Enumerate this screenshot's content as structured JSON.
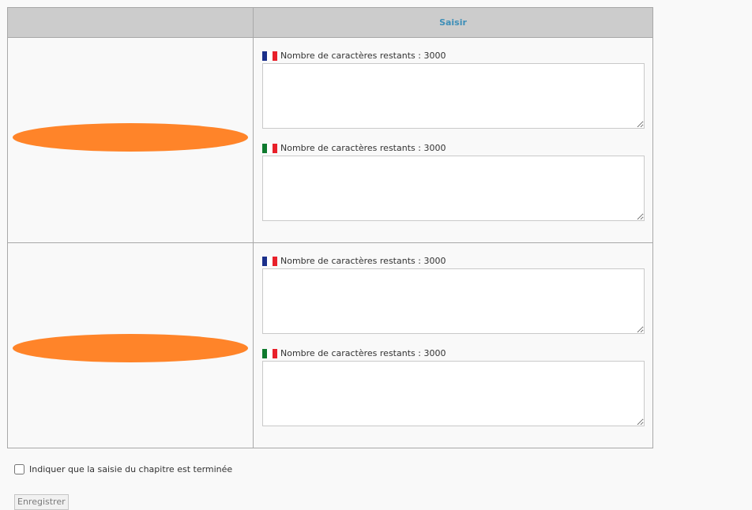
{
  "table": {
    "header_left": "",
    "header_right": "Saisir"
  },
  "flags": {
    "fr": {
      "left": "#1a2f8a",
      "middle": "#ffffff",
      "right": "#e8202a"
    },
    "it": {
      "left": "#0f7a2e",
      "middle": "#ffffff",
      "right": "#e8202a"
    }
  },
  "counter": {
    "label": "Nombre de caractères restants",
    "separator": " : "
  },
  "rows": [
    {
      "label_redacted": true,
      "fields": [
        {
          "lang": "fr",
          "flag_icon": "french-flag-icon",
          "remaining": "3000",
          "value": ""
        },
        {
          "lang": "it",
          "flag_icon": "italian-flag-icon",
          "remaining": "3000",
          "value": ""
        }
      ]
    },
    {
      "label_redacted": true,
      "fields": [
        {
          "lang": "fr",
          "flag_icon": "french-flag-icon",
          "remaining": "3000",
          "value": ""
        },
        {
          "lang": "it",
          "flag_icon": "italian-flag-icon",
          "remaining": "3000",
          "value": ""
        }
      ]
    }
  ],
  "completion": {
    "label": "Indiquer que la saisie du chapitre est terminée",
    "checked": false
  },
  "save_button": {
    "label": "Enregistrer"
  },
  "colors": {
    "header_bg": "#cccccc",
    "header_text": "#3e8fb8",
    "redaction": "#ff8429",
    "page_bg": "#f9f9f9"
  }
}
